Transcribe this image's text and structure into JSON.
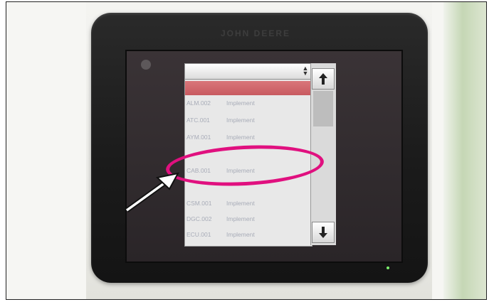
{
  "device": {
    "brand": "JOHN DEERE"
  },
  "list": {
    "dropdown_value": "",
    "items": [
      {
        "code": "ALM.002",
        "type": "Implement"
      },
      {
        "code": "ATC.001",
        "type": "Implement"
      },
      {
        "code": "AYM.001",
        "type": "Implement"
      },
      {
        "code": "CAB.001",
        "type": "Implement"
      },
      {
        "code": "CSM.001",
        "type": "Implement"
      },
      {
        "code": "DGC.002",
        "type": "Implement"
      },
      {
        "code": "ECU.001",
        "type": "Implement"
      }
    ],
    "highlighted_index": 3
  },
  "controls": {
    "scroll_up_icon": "arrow-up-icon",
    "scroll_down_icon": "arrow-down-icon"
  },
  "colors": {
    "highlight": "#e0107f",
    "selected_row": "#cc6166",
    "bezel": "#1e1e1e"
  }
}
